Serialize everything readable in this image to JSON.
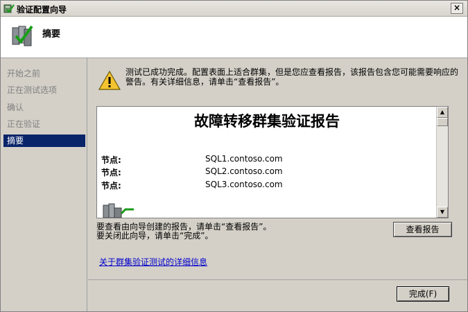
{
  "window": {
    "title": "验证配置向导",
    "close_glyph": "×"
  },
  "header": {
    "title": "摘要",
    "icon": "cluster-validate-icon"
  },
  "sidebar": {
    "items": [
      {
        "label": "开始之前",
        "active": false
      },
      {
        "label": "正在测试选项",
        "active": false
      },
      {
        "label": "确认",
        "active": false
      },
      {
        "label": "正在验证",
        "active": false
      },
      {
        "label": "摘要",
        "active": true
      }
    ]
  },
  "warning": {
    "icon": "warning-icon",
    "text": "测试已成功完成。配置表面上适合群集，但是您应查看报告，该报告包含您可能需要响应的警告。有关详细信息，请单击“查看报告”。"
  },
  "report": {
    "title": "故障转移群集验证报告",
    "nodes": [
      {
        "label": "节点:",
        "value": "SQL1.contoso.com"
      },
      {
        "label": "节点:",
        "value": "SQL2.contoso.com"
      },
      {
        "label": "节点:",
        "value": "SQL3.contoso.com"
      }
    ]
  },
  "hints": {
    "line1": "要查看由向导创建的报告，请单击“查看报告”。",
    "line2": "要关闭此向导，请单击“完成”。"
  },
  "buttons": {
    "view_report": "查看报告",
    "finish": "完成(F)"
  },
  "link": {
    "text": "关于群集验证测试的详细信息"
  },
  "colors": {
    "selection": "#0a246a",
    "link": "#0000cc"
  }
}
